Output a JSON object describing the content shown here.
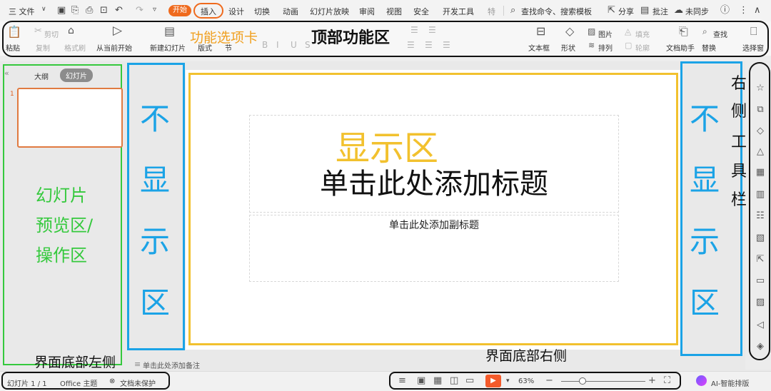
{
  "menubar": {
    "file": "三 文件",
    "tabs": [
      "开始",
      "插入",
      "设计",
      "切换",
      "动画",
      "幻灯片放映",
      "审阅",
      "视图",
      "安全",
      "开发工具",
      "特"
    ],
    "search": "查找命令、搜索模板",
    "share": "分享",
    "comment": "批注",
    "sync": "未同步"
  },
  "ribbon": {
    "paste": "粘贴",
    "cut": "剪切",
    "copy": "复制",
    "format_painter": "格式刷",
    "from_current": "从当前开始",
    "new_slide": "新建幻灯片",
    "layout": "版式",
    "section": "节",
    "textbox": "文本框",
    "shape": "形状",
    "arrange": "排列",
    "picture": "图片",
    "fill": "填充",
    "outline": "轮廓",
    "doc_assistant": "文档助手",
    "find": "查找",
    "replace": "替换",
    "select_pane": "选择窗"
  },
  "annotations": {
    "function_tab": "功能选项卡",
    "top_area": "顶部功能区",
    "left_area": [
      "幻灯片",
      "预览区/",
      "操作区"
    ],
    "not_display": [
      "不",
      "显",
      "示",
      "区"
    ],
    "display_area": "显示区",
    "right_toolbar": [
      "右",
      "侧",
      "工",
      "具",
      "栏"
    ],
    "bottom_left": "界面底部左侧",
    "bottom_right": "界面底部右侧"
  },
  "left_panel": {
    "tab_outline": "大纲",
    "tab_slides": "幻灯片",
    "slide_number": "1"
  },
  "slide": {
    "title_placeholder": "单击此处添加标题",
    "subtitle_placeholder": "单击此处添加副标题"
  },
  "notes": "单击此处添加备注",
  "statusbar": {
    "slide_count": "幻灯片 1 / 1",
    "theme": "Office 主题",
    "protect": "文档未保护",
    "zoom": "63%",
    "ai": "AI-智能排版"
  },
  "colors": {
    "accent": "#ef6a1d",
    "green_annotation": "#35c93d",
    "blue_annotation": "#1ba3e6",
    "yellow_annotation": "#f2c12e"
  }
}
